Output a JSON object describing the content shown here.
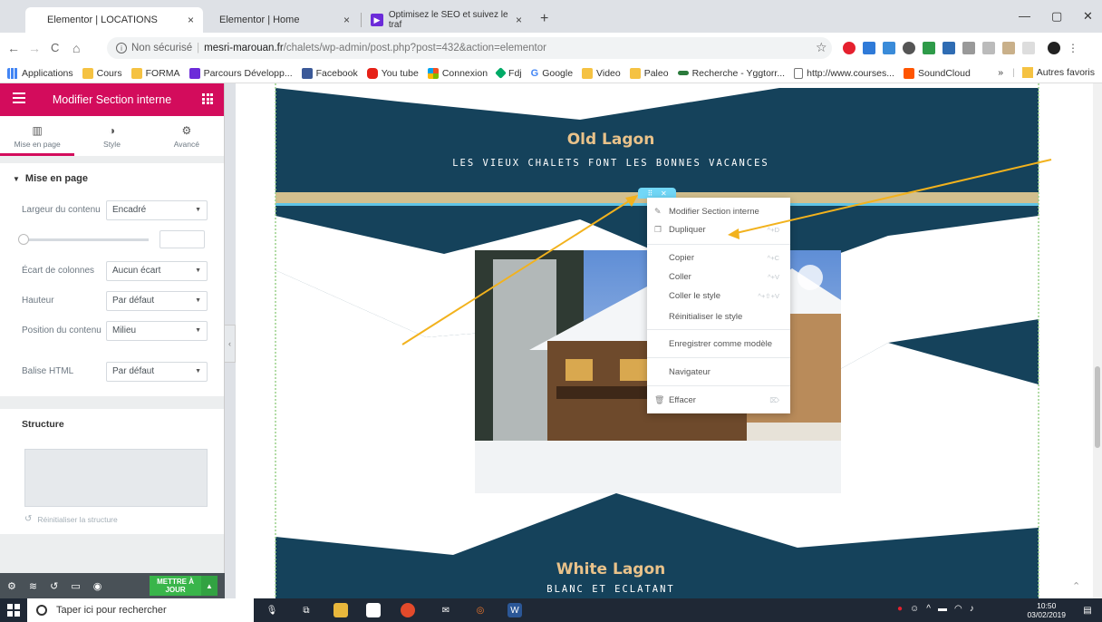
{
  "browser": {
    "tabs": [
      {
        "title": "Elementor | LOCATIONS",
        "close": "×"
      },
      {
        "title": "Elementor | Home",
        "close": "×"
      },
      {
        "title": "Optimisez le SEO et suivez le traf",
        "close": "×"
      }
    ],
    "new_tab": "+",
    "window_controls": {
      "minimize": "—",
      "maximize": "▢",
      "close": "✕"
    },
    "nav": {
      "back": "←",
      "forward": "→",
      "reload": "C",
      "home": "⌂"
    },
    "address": {
      "security": "Non sécurisé",
      "host": "mesri-marouan.fr",
      "path": "/chalets/wp-admin/post.php?post=432&action=elementor"
    },
    "bookmarks": [
      {
        "label": "Applications",
        "icon": "apps-icon"
      },
      {
        "label": "Cours",
        "icon": "folder-icon"
      },
      {
        "label": "FORMA",
        "icon": "folder-icon"
      },
      {
        "label": "Parcours Développ...",
        "icon": "openclassrooms-icon"
      },
      {
        "label": "Facebook",
        "icon": "facebook-icon"
      },
      {
        "label": "You tube",
        "icon": "youtube-icon"
      },
      {
        "label": "Connexion",
        "icon": "microsoft-icon"
      },
      {
        "label": "Fdj",
        "icon": "fdj-icon"
      },
      {
        "label": "Google",
        "icon": "google-icon"
      },
      {
        "label": "Video",
        "icon": "folder-icon"
      },
      {
        "label": "Paleo",
        "icon": "folder-icon"
      },
      {
        "label": "Recherche - Yggtorr...",
        "icon": "ygg-icon"
      },
      {
        "label": "http://www.courses...",
        "icon": "page-icon"
      },
      {
        "label": "SoundCloud",
        "icon": "soundcloud-icon"
      }
    ],
    "bookmarks_overflow": "»",
    "other_bookmarks": "Autres favoris"
  },
  "panel": {
    "title": "Modifier Section interne",
    "tabs": [
      {
        "label": "Mise en page",
        "icon": "layout-icon",
        "active": true
      },
      {
        "label": "Style",
        "icon": "contrast-icon",
        "active": false
      },
      {
        "label": "Avancé",
        "icon": "gear-icon",
        "active": false
      }
    ],
    "section_title": "Mise en page",
    "controls": {
      "content_width": {
        "label": "Largeur du contenu",
        "value": "Encadré"
      },
      "column_gap": {
        "label": "Écart de colonnes",
        "value": "Aucun écart"
      },
      "height": {
        "label": "Hauteur",
        "value": "Par défaut"
      },
      "content_position": {
        "label": "Position du contenu",
        "value": "Milieu"
      },
      "html_tag": {
        "label": "Balise HTML",
        "value": "Par défaut"
      }
    },
    "structure_title": "Structure",
    "reset_structure": "Réinitialiser la structure",
    "update_button": {
      "line1": "METTRE À",
      "line2": "JOUR"
    },
    "accent_color": "#d30c5c"
  },
  "canvas": {
    "section1": {
      "title": "Old Lagon",
      "subtitle": "LES VIEUX CHALETS FONT LES BONNES VACANCES"
    },
    "section2": {
      "title": "White Lagon",
      "subtitle": "BLANC ET ECLATANT"
    },
    "navy_color": "#15425b",
    "title_color": "#e9c28a"
  },
  "context_menu": {
    "items": [
      {
        "label": "Modifier Section interne",
        "icon": "pencil-icon",
        "shortcut": ""
      },
      {
        "label": "Dupliquer",
        "icon": "copy-icon",
        "shortcut": "^+D"
      },
      {
        "label": "Copier",
        "icon": "",
        "shortcut": "^+C"
      },
      {
        "label": "Coller",
        "icon": "",
        "shortcut": "^+V"
      },
      {
        "label": "Coller le style",
        "icon": "",
        "shortcut": "^+⇧+V"
      },
      {
        "label": "Réinitialiser le style",
        "icon": "",
        "shortcut": ""
      },
      {
        "label": "Enregistrer comme modèle",
        "icon": "",
        "shortcut": ""
      },
      {
        "label": "Navigateur",
        "icon": "",
        "shortcut": ""
      },
      {
        "label": "Effacer",
        "icon": "trash-icon",
        "shortcut": "⌦"
      }
    ]
  },
  "taskbar": {
    "search_placeholder": "Taper ici pour rechercher",
    "time": "10:50",
    "date": "03/02/2019"
  }
}
